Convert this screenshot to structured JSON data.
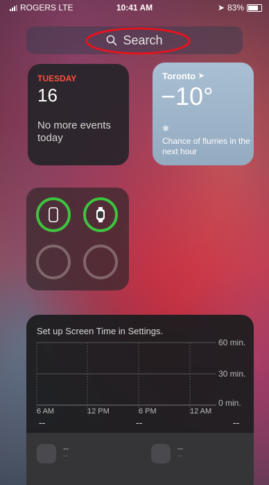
{
  "status_bar": {
    "carrier": "ROGERS  LTE",
    "time": "10:41 AM",
    "battery": "83%"
  },
  "search": {
    "label": "Search"
  },
  "calendar": {
    "day": "TUESDAY",
    "date": "16",
    "message": "No more events today"
  },
  "weather": {
    "city": "Toronto",
    "temperature": "−10°",
    "description": "Chance of flurries in the next hour"
  },
  "screen_time": {
    "title": "Set up Screen Time in Settings.",
    "y_labels": [
      "60 min.",
      "30 min.",
      "0 min."
    ],
    "x_labels": [
      "6 AM",
      "12 PM",
      "6 PM",
      "12 AM"
    ],
    "placeholders": [
      "--",
      "--",
      "--"
    ],
    "items": [
      {
        "title": "--",
        "subtitle": "--"
      },
      {
        "title": "--",
        "subtitle": "--"
      }
    ]
  },
  "colors": {
    "accent_red": "#ff5040",
    "ring_green": "#3ec43e"
  }
}
